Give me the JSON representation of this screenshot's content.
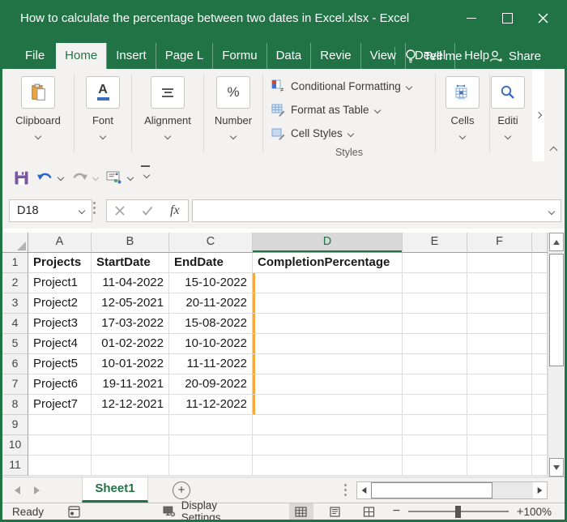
{
  "colors": {
    "green": "#217346",
    "orange": "#f5a93b",
    "save-purple": "#7a56a5",
    "undo-blue": "#2a66c4",
    "icon-blue": "#3f6fbf"
  },
  "titlebar": {
    "title": "How to calculate the percentage between two dates in Excel.xlsx  -  Excel"
  },
  "tabs": {
    "items": [
      "File",
      "Home",
      "Insert",
      "Page L",
      "Formu",
      "Data",
      "Revie",
      "View",
      "Devel",
      "Help"
    ],
    "active": "Home",
    "tell_me": "Tell me",
    "share": "Share"
  },
  "ribbon": {
    "groups": {
      "clipboard": "Clipboard",
      "font": "Font",
      "alignment": "Alignment",
      "number": "Number",
      "cells": "Cells",
      "editing": "Editi"
    },
    "styles": {
      "name": "Styles",
      "conditional_formatting": "Conditional Formatting",
      "format_as_table": "Format as Table",
      "cell_styles": "Cell Styles"
    }
  },
  "icons": {
    "font_group_glyph": "A",
    "percent_glyph": "%"
  },
  "formula_bar": {
    "name_box": "D18",
    "fx_label": "fx",
    "formula_value": ""
  },
  "sheet": {
    "column_headers": [
      "A",
      "B",
      "C",
      "D",
      "E",
      "F"
    ],
    "selected_column": "D",
    "column_alignments": [
      "left",
      "right",
      "right",
      "left",
      "left",
      "left"
    ],
    "highlight": {
      "column": "D",
      "rows_from": 2,
      "rows_to": 8
    },
    "rows": [
      {
        "n": "1",
        "bold": true,
        "cells": [
          "Projects",
          "StartDate",
          "EndDate",
          "CompletionPercentage",
          "",
          ""
        ]
      },
      {
        "n": "2",
        "cells": [
          "Project1",
          "11-04-2022",
          "15-10-2022",
          "",
          "",
          ""
        ]
      },
      {
        "n": "3",
        "cells": [
          "Project2",
          "12-05-2021",
          "20-11-2022",
          "",
          "",
          ""
        ]
      },
      {
        "n": "4",
        "cells": [
          "Project3",
          "17-03-2022",
          "15-08-2022",
          "",
          "",
          ""
        ]
      },
      {
        "n": "5",
        "cells": [
          "Project4",
          "01-02-2022",
          "10-10-2022",
          "",
          "",
          ""
        ]
      },
      {
        "n": "6",
        "cells": [
          "Project5",
          "10-01-2022",
          "11-11-2022",
          "",
          "",
          ""
        ]
      },
      {
        "n": "7",
        "cells": [
          "Project6",
          "19-11-2021",
          "20-09-2022",
          "",
          "",
          ""
        ]
      },
      {
        "n": "8",
        "cells": [
          "Project7",
          "12-12-2021",
          "11-12-2022",
          "",
          "",
          ""
        ]
      },
      {
        "n": "9",
        "cells": [
          "",
          "",
          "",
          "",
          "",
          ""
        ]
      },
      {
        "n": "10",
        "cells": [
          "",
          "",
          "",
          "",
          "",
          ""
        ]
      },
      {
        "n": "11",
        "cells": [
          "",
          "",
          "",
          "",
          "",
          ""
        ]
      }
    ]
  },
  "sheet_tabs": {
    "active": "Sheet1",
    "new_sheet_glyph": "+"
  },
  "status_bar": {
    "mode": "Ready",
    "display_settings": "Display Settings",
    "zoom_out_glyph": "−",
    "zoom_in_glyph": "+",
    "zoom_level": "100%"
  }
}
